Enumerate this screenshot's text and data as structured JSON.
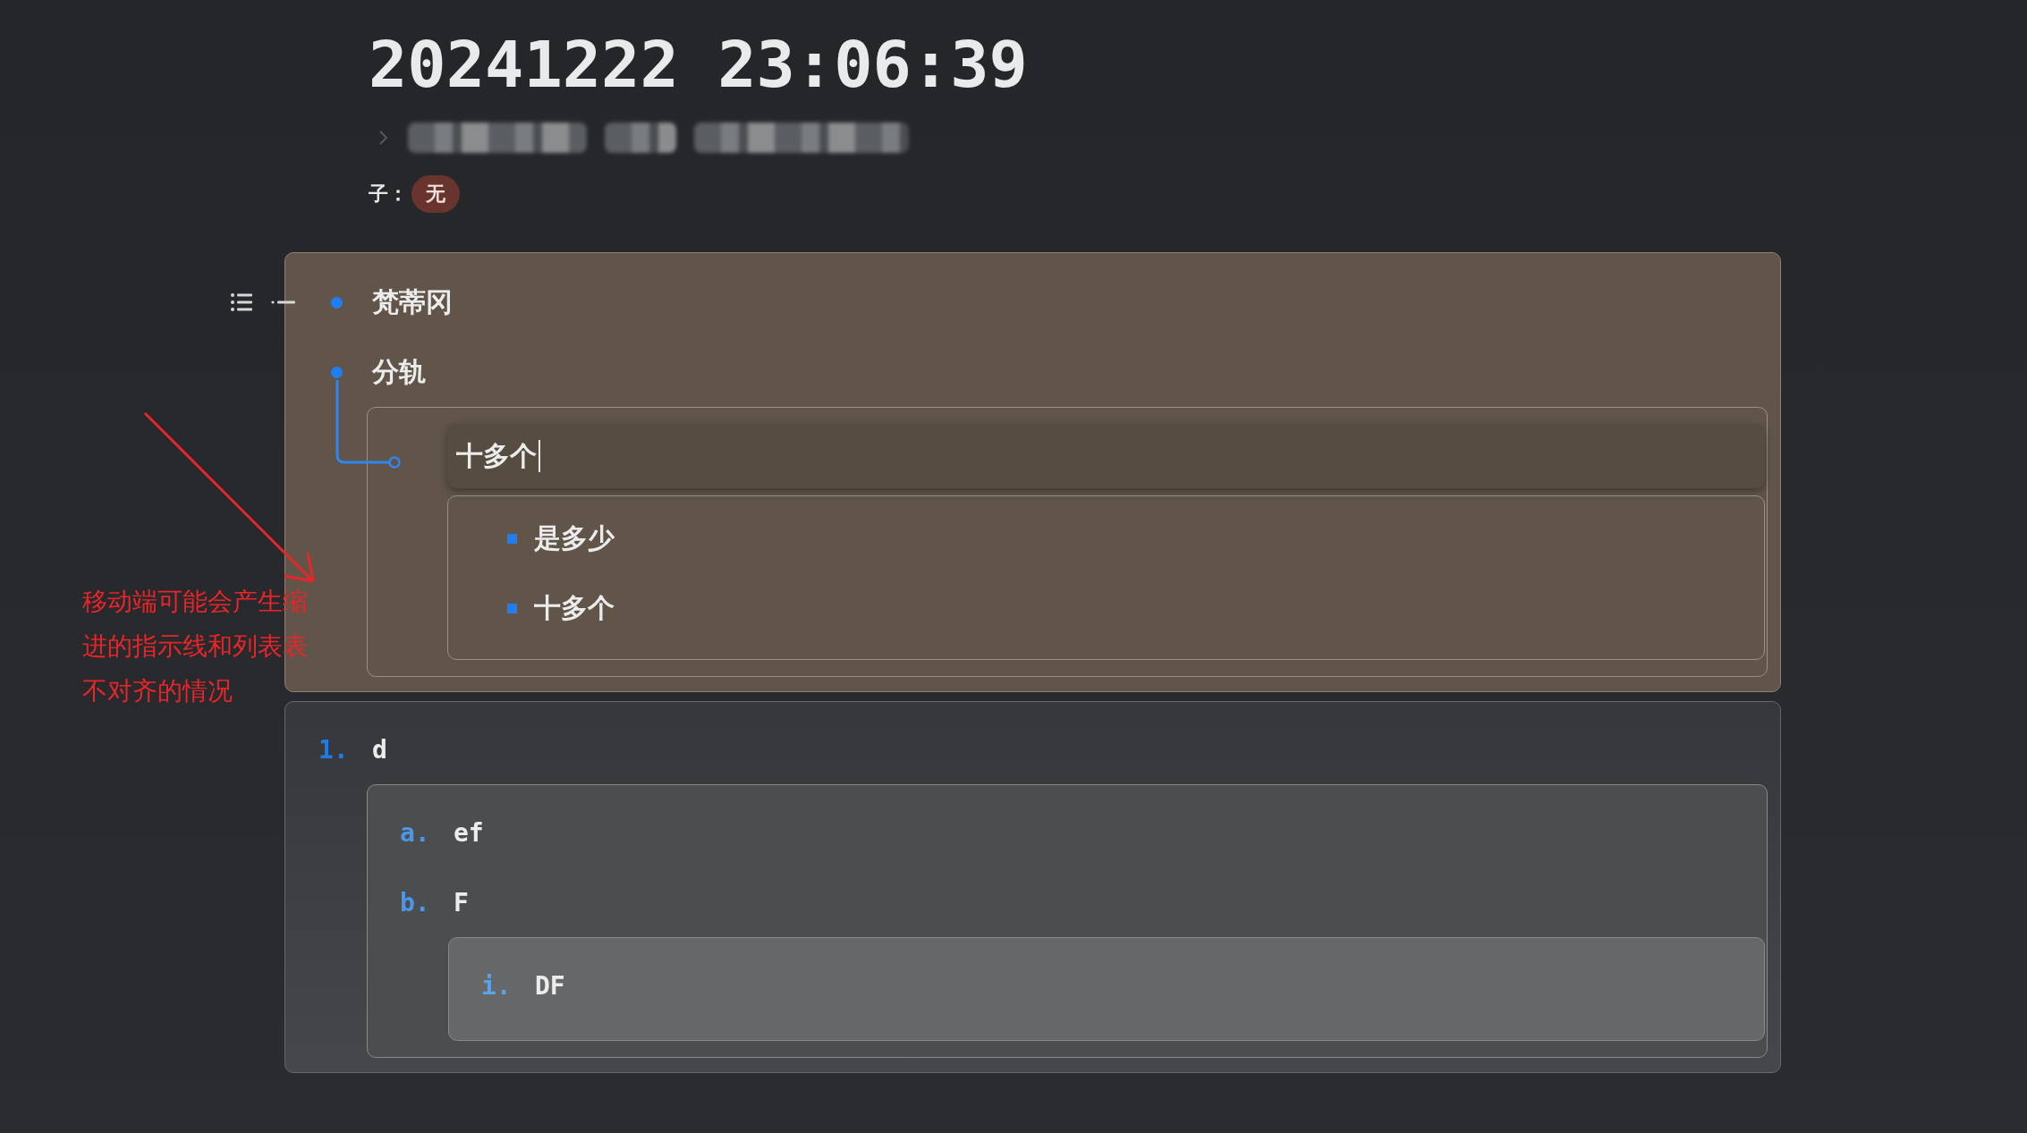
{
  "title": "20241222 23:06:39",
  "child_field": {
    "label": "子：",
    "value": "无"
  },
  "blocks": [
    {
      "kind": "bullet",
      "items": [
        {
          "text": "梵蒂冈"
        },
        {
          "text": "分轨",
          "children": [
            {
              "text": "十多个",
              "focused": true,
              "children": [
                {
                  "text": "是多少"
                },
                {
                  "text": "十多个"
                }
              ]
            }
          ]
        }
      ]
    },
    {
      "kind": "ordered",
      "items": [
        {
          "marker": "1.",
          "text": "d",
          "children": [
            {
              "marker": "a.",
              "text": "ef"
            },
            {
              "marker": "b.",
              "text": "F",
              "children": [
                {
                  "marker": "i.",
                  "text": "DF"
                }
              ]
            }
          ]
        }
      ]
    }
  ],
  "annotation": {
    "text": "移动端可能会产生缩进的指示线和列表表不对齐的情况"
  }
}
